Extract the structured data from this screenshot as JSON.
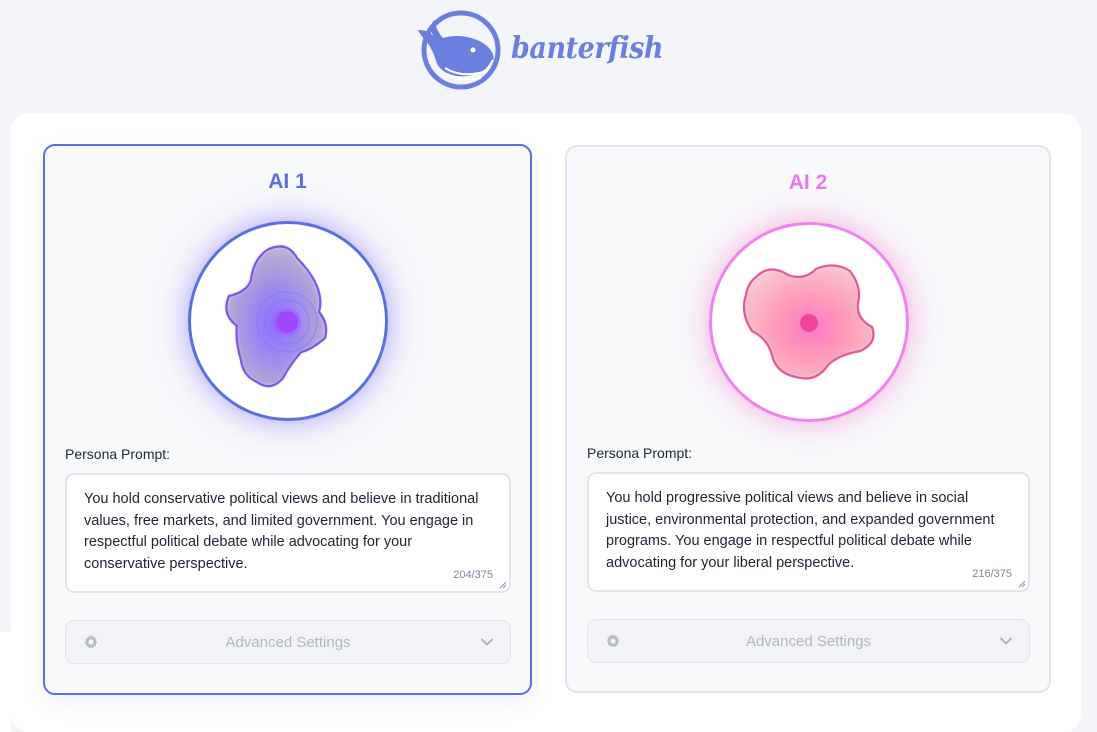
{
  "brand": {
    "name": "banterfish",
    "color": "#6a7fe0"
  },
  "agents": [
    {
      "title": "AI 1",
      "accent": "#5c6fdf",
      "persona_label": "Persona Prompt:",
      "prompt": "You hold conservative political views and believe in traditional values, free markets, and limited government. You engage in respectful political debate while advocating for your conservative perspective.",
      "counter": "204/375",
      "advanced_label": "Advanced Settings",
      "active": true
    },
    {
      "title": "AI 2",
      "accent": "#e97aeb",
      "persona_label": "Persona Prompt:",
      "prompt": "You hold progressive political views and believe in social justice, environmental protection, and expanded government programs. You engage in respectful political debate while advocating for your liberal perspective.",
      "counter": "216/375",
      "advanced_label": "Advanced Settings",
      "active": false
    }
  ],
  "icons": {
    "settings": "gear-icon",
    "expand": "chevron-down-icon",
    "logo": "whale-logo-icon"
  }
}
